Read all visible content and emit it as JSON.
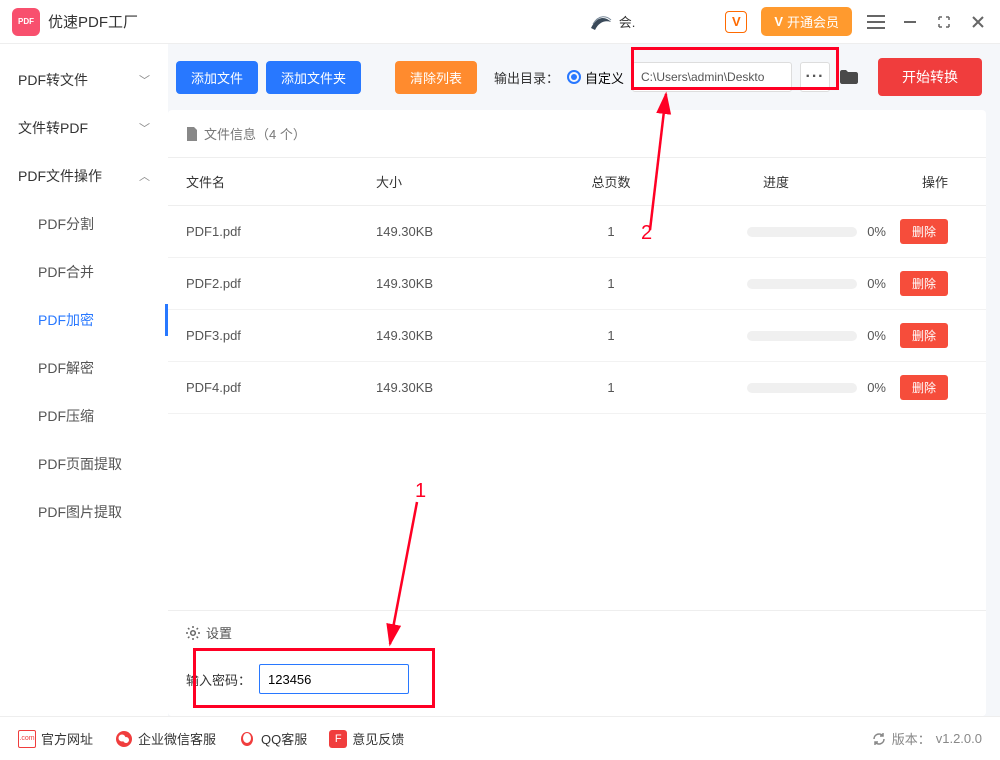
{
  "app": {
    "title": "优速PDF工厂",
    "user_hint": "会."
  },
  "titlebar": {
    "vip_button": "开通会员"
  },
  "sidebar": {
    "groups": [
      {
        "label": "PDF转文件",
        "expanded": false
      },
      {
        "label": "文件转PDF",
        "expanded": false
      },
      {
        "label": "PDF文件操作",
        "expanded": true
      }
    ],
    "items": [
      {
        "label": "PDF分割",
        "active": false
      },
      {
        "label": "PDF合并",
        "active": false
      },
      {
        "label": "PDF加密",
        "active": true
      },
      {
        "label": "PDF解密",
        "active": false
      },
      {
        "label": "PDF压缩",
        "active": false
      },
      {
        "label": "PDF页面提取",
        "active": false
      },
      {
        "label": "PDF图片提取",
        "active": false
      }
    ]
  },
  "toolbar": {
    "add_file": "添加文件",
    "add_folder": "添加文件夹",
    "clear_list": "清除列表",
    "output_label": "输出目录：",
    "output_mode": "自定义",
    "output_path": "C:\\Users\\admin\\Deskto",
    "start": "开始转换"
  },
  "table": {
    "header_text": "文件信息（4 个）",
    "columns": {
      "name": "文件名",
      "size": "大小",
      "pages": "总页数",
      "progress": "进度",
      "action": "操作"
    },
    "rows": [
      {
        "name": "PDF1.pdf",
        "size": "149.30KB",
        "pages": "1",
        "progress": "0%"
      },
      {
        "name": "PDF2.pdf",
        "size": "149.30KB",
        "pages": "1",
        "progress": "0%"
      },
      {
        "name": "PDF3.pdf",
        "size": "149.30KB",
        "pages": "1",
        "progress": "0%"
      },
      {
        "name": "PDF4.pdf",
        "size": "149.30KB",
        "pages": "1",
        "progress": "0%"
      }
    ],
    "delete_label": "删除"
  },
  "settings": {
    "title": "设置",
    "password_label": "输入密码：",
    "password_value": "123456"
  },
  "footer": {
    "site": "官方网址",
    "wechat": "企业微信客服",
    "qq": "QQ客服",
    "feedback": "意见反馈",
    "version_label": "版本：",
    "version": "v1.2.0.0"
  },
  "annotations": {
    "one": "1",
    "two": "2"
  }
}
